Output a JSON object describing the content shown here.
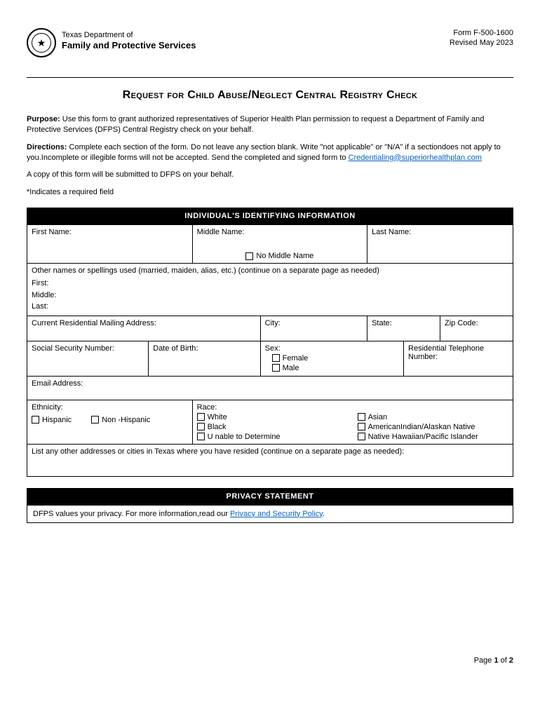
{
  "header": {
    "dept_line1": "Texas Department of",
    "dept_line2": "Family and Protective Services",
    "form_number": "Form F-500-1600",
    "revised": "Revised May 2023"
  },
  "title": "Request for Child Abuse/Neglect Central Registry Check",
  "purpose": {
    "label": "Purpose:",
    "text": " Use this form to grant authorized representatives of Superior Health Plan permission to request a Department of Family and Protective Services (DFPS) Central Registry check on your behalf."
  },
  "directions": {
    "label": "Directions:",
    "text_before_link": " Complete each section of the form. Do not leave any section blank. Write \"not applicable\" or \"N/A\" if a sectiondoes not apply to you.Incomplete or illegible forms will not be accepted. Send the completed and signed form to ",
    "link_text": "Credentialing@superiorhealthplan.com"
  },
  "copy_note": "A copy of this form will be submitted to DFPS on your behalf.",
  "required_note": "*Indicates a required field",
  "section1": {
    "header": "INDIVIDUAL'S IDENTIFYING INFORMATION",
    "first_name": "First Name:",
    "middle_name": "Middle Name:",
    "no_middle": "No Middle Name",
    "last_name": "Last Name:",
    "other_names_label": "Other names or spellings used (married, maiden, alias, etc.) (continue on a separate page as needed)",
    "other_first": "First:",
    "other_middle": "Middle:",
    "other_last": "Last:",
    "address": "Current Residential Mailing Address:",
    "city": "City:",
    "state": "State:",
    "zip": "Zip Code:",
    "ssn": "Social Security Number:",
    "dob": "Date of Birth:",
    "sex": "Sex:",
    "sex_female": "Female",
    "sex_male": "Male",
    "phone": "Residential Telephone Number:",
    "email": "Email Address:",
    "ethnicity": "Ethnicity:",
    "eth_hispanic": "Hispanic",
    "eth_nonhispanic": "Non -Hispanic",
    "race": "Race:",
    "race_white": "White",
    "race_black": "Black",
    "race_unable": "U nable to Determine",
    "race_asian": "Asian",
    "race_aian": "AmericanIndian/Alaskan Native",
    "race_nhpi": "Native Hawaiian/Pacific Islander",
    "list_addresses": "List any other addresses or cities in Texas where you have resided (continue on a separate page as needed):"
  },
  "section2": {
    "header": "PRIVACY STATEMENT",
    "text_before": "DFPS values your privacy. For more information,read our ",
    "link": "Privacy and Security Policy",
    "text_after": "."
  },
  "page": {
    "label": "Page ",
    "current": "1",
    "of": " of ",
    "total": "2"
  }
}
